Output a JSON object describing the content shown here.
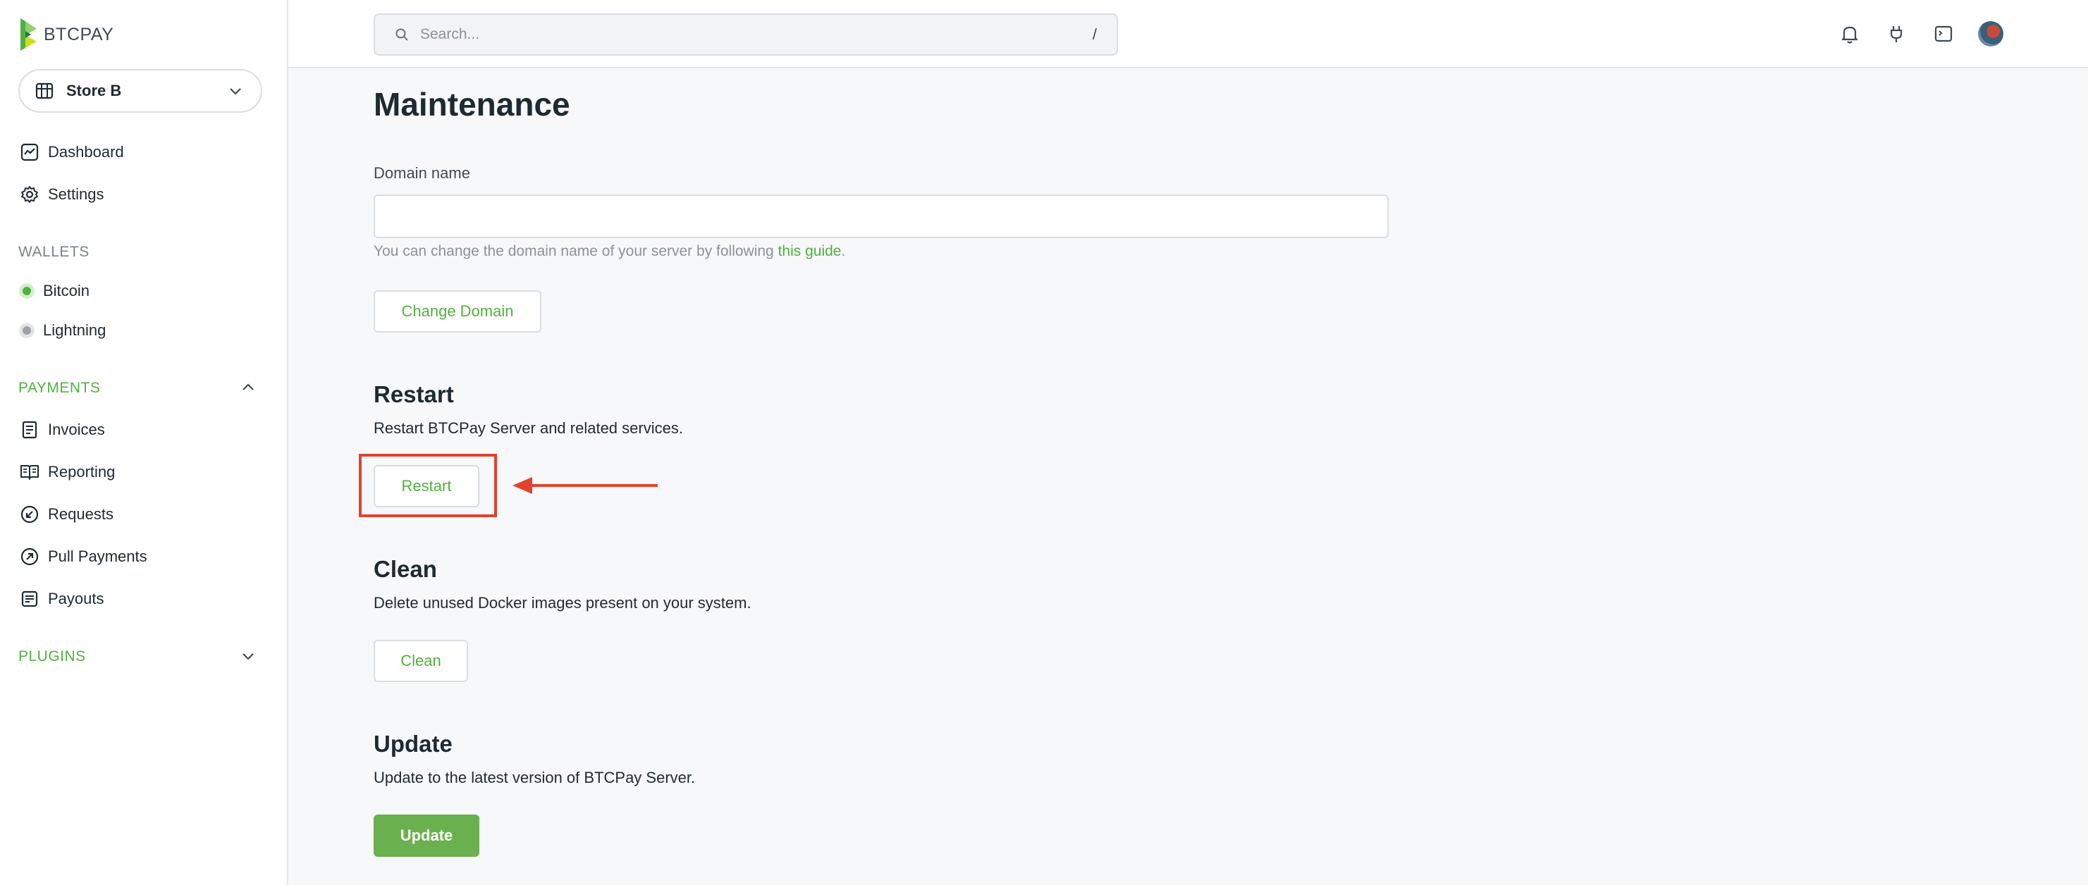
{
  "brand": {
    "name": "BTCPAY"
  },
  "store_selector": {
    "label": "Store B"
  },
  "sidebar": {
    "main_items": [
      {
        "label": "Dashboard",
        "icon": "dashboard-icon"
      },
      {
        "label": "Settings",
        "icon": "gear-icon"
      }
    ],
    "wallets_header": "WALLETS",
    "wallets": [
      {
        "label": "Bitcoin",
        "status": "active"
      },
      {
        "label": "Lightning",
        "status": "inactive"
      }
    ],
    "payments_header": "PAYMENTS",
    "payments": [
      {
        "label": "Invoices",
        "icon": "invoice-icon"
      },
      {
        "label": "Reporting",
        "icon": "reporting-icon"
      },
      {
        "label": "Requests",
        "icon": "requests-icon"
      },
      {
        "label": "Pull Payments",
        "icon": "pull-payments-icon"
      },
      {
        "label": "Payouts",
        "icon": "payouts-icon"
      }
    ],
    "plugins_header": "PLUGINS"
  },
  "search": {
    "placeholder": "Search...",
    "shortcut": "/"
  },
  "page": {
    "title": "Maintenance",
    "domain": {
      "label": "Domain name",
      "value": "",
      "help_prefix": "You can change the domain name of your server by following ",
      "help_link": "this guide",
      "help_suffix": ".",
      "button": "Change Domain"
    },
    "restart": {
      "title": "Restart",
      "description": "Restart BTCPay Server and related services.",
      "button": "Restart"
    },
    "clean": {
      "title": "Clean",
      "description": "Delete unused Docker images present on your system.",
      "button": "Clean"
    },
    "update": {
      "title": "Update",
      "description": "Update to the latest version of BTCPay Server.",
      "button": "Update"
    }
  },
  "colors": {
    "accent": "#51b13e",
    "primary_button": "#6bb04f",
    "annotation": "#e3422e"
  }
}
